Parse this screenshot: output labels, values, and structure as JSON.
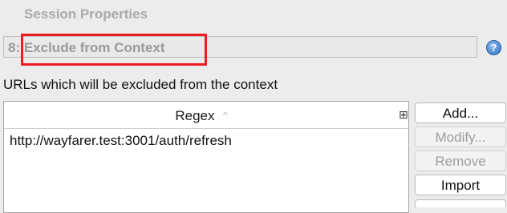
{
  "window": {
    "title": "Session Properties"
  },
  "panel": {
    "header": "8: Exclude from Context"
  },
  "help": {
    "glyph": "?"
  },
  "description": "URLs which will be excluded from the context",
  "table": {
    "columns": [
      {
        "label": "Regex",
        "sort_glyph": "^"
      }
    ],
    "column_chooser_glyph": "⊞",
    "rows": [
      {
        "regex": "http://wayfarer.test:3001/auth/refresh"
      }
    ]
  },
  "buttons": {
    "add": "Add...",
    "modify": "Modify...",
    "remove": "Remove",
    "import": "Import"
  },
  "colors": {
    "highlight": "#ee1b22",
    "help_icon": "#2f6fc4"
  }
}
